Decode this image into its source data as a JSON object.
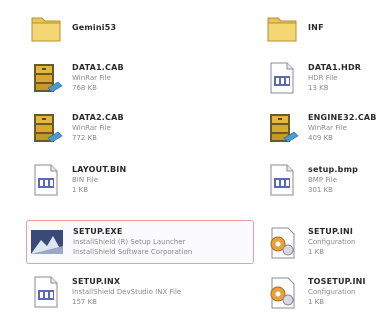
{
  "files": [
    {
      "name": "Gemini53",
      "type": "",
      "size": "",
      "icon": "folder-icon"
    },
    {
      "name": "INF",
      "type": "",
      "size": "",
      "icon": "folder-icon"
    },
    {
      "name": "DATA1.CAB",
      "type": "WinRar File",
      "size": "768 KB",
      "icon": "cabinet-archive-icon"
    },
    {
      "name": "DATA1.HDR",
      "type": "HDR File",
      "size": "13 KB",
      "icon": "hdr-file-icon"
    },
    {
      "name": "DATA2.CAB",
      "type": "WinRar File",
      "size": "772 KB",
      "icon": "cabinet-archive-icon"
    },
    {
      "name": "ENGINE32.CAB",
      "type": "WinRar File",
      "size": "409 KB",
      "icon": "cabinet-archive-icon"
    },
    {
      "name": "LAYOUT.BIN",
      "type": "BIN File",
      "size": "1 KB",
      "icon": "bin-file-icon"
    },
    {
      "name": "setup.bmp",
      "type": "BMP File",
      "size": "301 KB",
      "icon": "bmp-file-icon"
    },
    {
      "name": "SETUP.EXE",
      "type": "InstallShield (R) Setup Launcher",
      "size": "InstallShield Software Corporation",
      "icon": "installshield-setup-icon"
    },
    {
      "name": "SETUP.INI",
      "type": "Configuration",
      "size": "1 KB",
      "icon": "ini-settings-icon"
    },
    {
      "name": "SETUP.INX",
      "type": "InstallShield DevStudio INX File",
      "size": "157 KB",
      "icon": "inx-file-icon"
    },
    {
      "name": "TOSETUP.INI",
      "type": "Configuration",
      "size": "1 KB",
      "icon": "ini-settings-icon"
    }
  ]
}
